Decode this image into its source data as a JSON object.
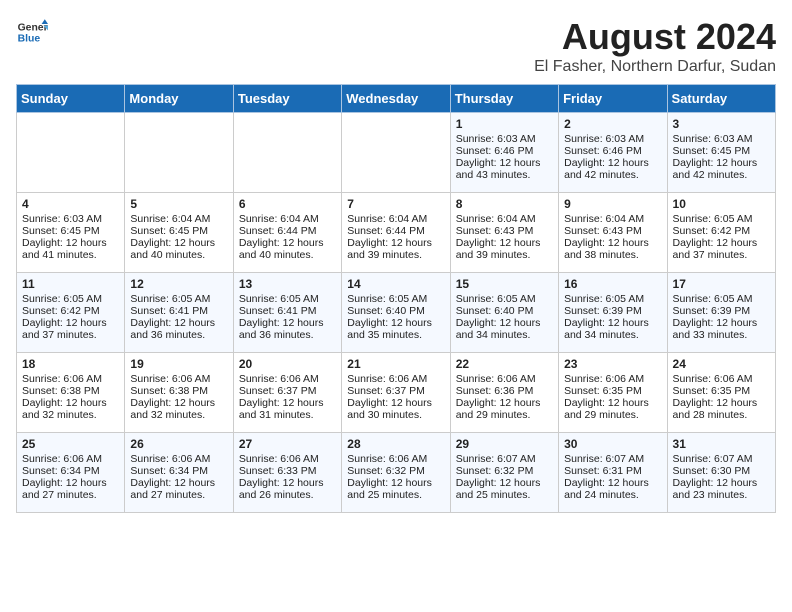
{
  "header": {
    "logo_line1": "General",
    "logo_line2": "Blue",
    "title": "August 2024",
    "subtitle": "El Fasher, Northern Darfur, Sudan"
  },
  "days_of_week": [
    "Sunday",
    "Monday",
    "Tuesday",
    "Wednesday",
    "Thursday",
    "Friday",
    "Saturday"
  ],
  "weeks": [
    [
      {
        "day": "",
        "info": ""
      },
      {
        "day": "",
        "info": ""
      },
      {
        "day": "",
        "info": ""
      },
      {
        "day": "",
        "info": ""
      },
      {
        "day": "1",
        "info": "Sunrise: 6:03 AM\nSunset: 6:46 PM\nDaylight: 12 hours\nand 43 minutes."
      },
      {
        "day": "2",
        "info": "Sunrise: 6:03 AM\nSunset: 6:46 PM\nDaylight: 12 hours\nand 42 minutes."
      },
      {
        "day": "3",
        "info": "Sunrise: 6:03 AM\nSunset: 6:45 PM\nDaylight: 12 hours\nand 42 minutes."
      }
    ],
    [
      {
        "day": "4",
        "info": "Sunrise: 6:03 AM\nSunset: 6:45 PM\nDaylight: 12 hours\nand 41 minutes."
      },
      {
        "day": "5",
        "info": "Sunrise: 6:04 AM\nSunset: 6:45 PM\nDaylight: 12 hours\nand 40 minutes."
      },
      {
        "day": "6",
        "info": "Sunrise: 6:04 AM\nSunset: 6:44 PM\nDaylight: 12 hours\nand 40 minutes."
      },
      {
        "day": "7",
        "info": "Sunrise: 6:04 AM\nSunset: 6:44 PM\nDaylight: 12 hours\nand 39 minutes."
      },
      {
        "day": "8",
        "info": "Sunrise: 6:04 AM\nSunset: 6:43 PM\nDaylight: 12 hours\nand 39 minutes."
      },
      {
        "day": "9",
        "info": "Sunrise: 6:04 AM\nSunset: 6:43 PM\nDaylight: 12 hours\nand 38 minutes."
      },
      {
        "day": "10",
        "info": "Sunrise: 6:05 AM\nSunset: 6:42 PM\nDaylight: 12 hours\nand 37 minutes."
      }
    ],
    [
      {
        "day": "11",
        "info": "Sunrise: 6:05 AM\nSunset: 6:42 PM\nDaylight: 12 hours\nand 37 minutes."
      },
      {
        "day": "12",
        "info": "Sunrise: 6:05 AM\nSunset: 6:41 PM\nDaylight: 12 hours\nand 36 minutes."
      },
      {
        "day": "13",
        "info": "Sunrise: 6:05 AM\nSunset: 6:41 PM\nDaylight: 12 hours\nand 36 minutes."
      },
      {
        "day": "14",
        "info": "Sunrise: 6:05 AM\nSunset: 6:40 PM\nDaylight: 12 hours\nand 35 minutes."
      },
      {
        "day": "15",
        "info": "Sunrise: 6:05 AM\nSunset: 6:40 PM\nDaylight: 12 hours\nand 34 minutes."
      },
      {
        "day": "16",
        "info": "Sunrise: 6:05 AM\nSunset: 6:39 PM\nDaylight: 12 hours\nand 34 minutes."
      },
      {
        "day": "17",
        "info": "Sunrise: 6:05 AM\nSunset: 6:39 PM\nDaylight: 12 hours\nand 33 minutes."
      }
    ],
    [
      {
        "day": "18",
        "info": "Sunrise: 6:06 AM\nSunset: 6:38 PM\nDaylight: 12 hours\nand 32 minutes."
      },
      {
        "day": "19",
        "info": "Sunrise: 6:06 AM\nSunset: 6:38 PM\nDaylight: 12 hours\nand 32 minutes."
      },
      {
        "day": "20",
        "info": "Sunrise: 6:06 AM\nSunset: 6:37 PM\nDaylight: 12 hours\nand 31 minutes."
      },
      {
        "day": "21",
        "info": "Sunrise: 6:06 AM\nSunset: 6:37 PM\nDaylight: 12 hours\nand 30 minutes."
      },
      {
        "day": "22",
        "info": "Sunrise: 6:06 AM\nSunset: 6:36 PM\nDaylight: 12 hours\nand 29 minutes."
      },
      {
        "day": "23",
        "info": "Sunrise: 6:06 AM\nSunset: 6:35 PM\nDaylight: 12 hours\nand 29 minutes."
      },
      {
        "day": "24",
        "info": "Sunrise: 6:06 AM\nSunset: 6:35 PM\nDaylight: 12 hours\nand 28 minutes."
      }
    ],
    [
      {
        "day": "25",
        "info": "Sunrise: 6:06 AM\nSunset: 6:34 PM\nDaylight: 12 hours\nand 27 minutes."
      },
      {
        "day": "26",
        "info": "Sunrise: 6:06 AM\nSunset: 6:34 PM\nDaylight: 12 hours\nand 27 minutes."
      },
      {
        "day": "27",
        "info": "Sunrise: 6:06 AM\nSunset: 6:33 PM\nDaylight: 12 hours\nand 26 minutes."
      },
      {
        "day": "28",
        "info": "Sunrise: 6:06 AM\nSunset: 6:32 PM\nDaylight: 12 hours\nand 25 minutes."
      },
      {
        "day": "29",
        "info": "Sunrise: 6:07 AM\nSunset: 6:32 PM\nDaylight: 12 hours\nand 25 minutes."
      },
      {
        "day": "30",
        "info": "Sunrise: 6:07 AM\nSunset: 6:31 PM\nDaylight: 12 hours\nand 24 minutes."
      },
      {
        "day": "31",
        "info": "Sunrise: 6:07 AM\nSunset: 6:30 PM\nDaylight: 12 hours\nand 23 minutes."
      }
    ]
  ]
}
